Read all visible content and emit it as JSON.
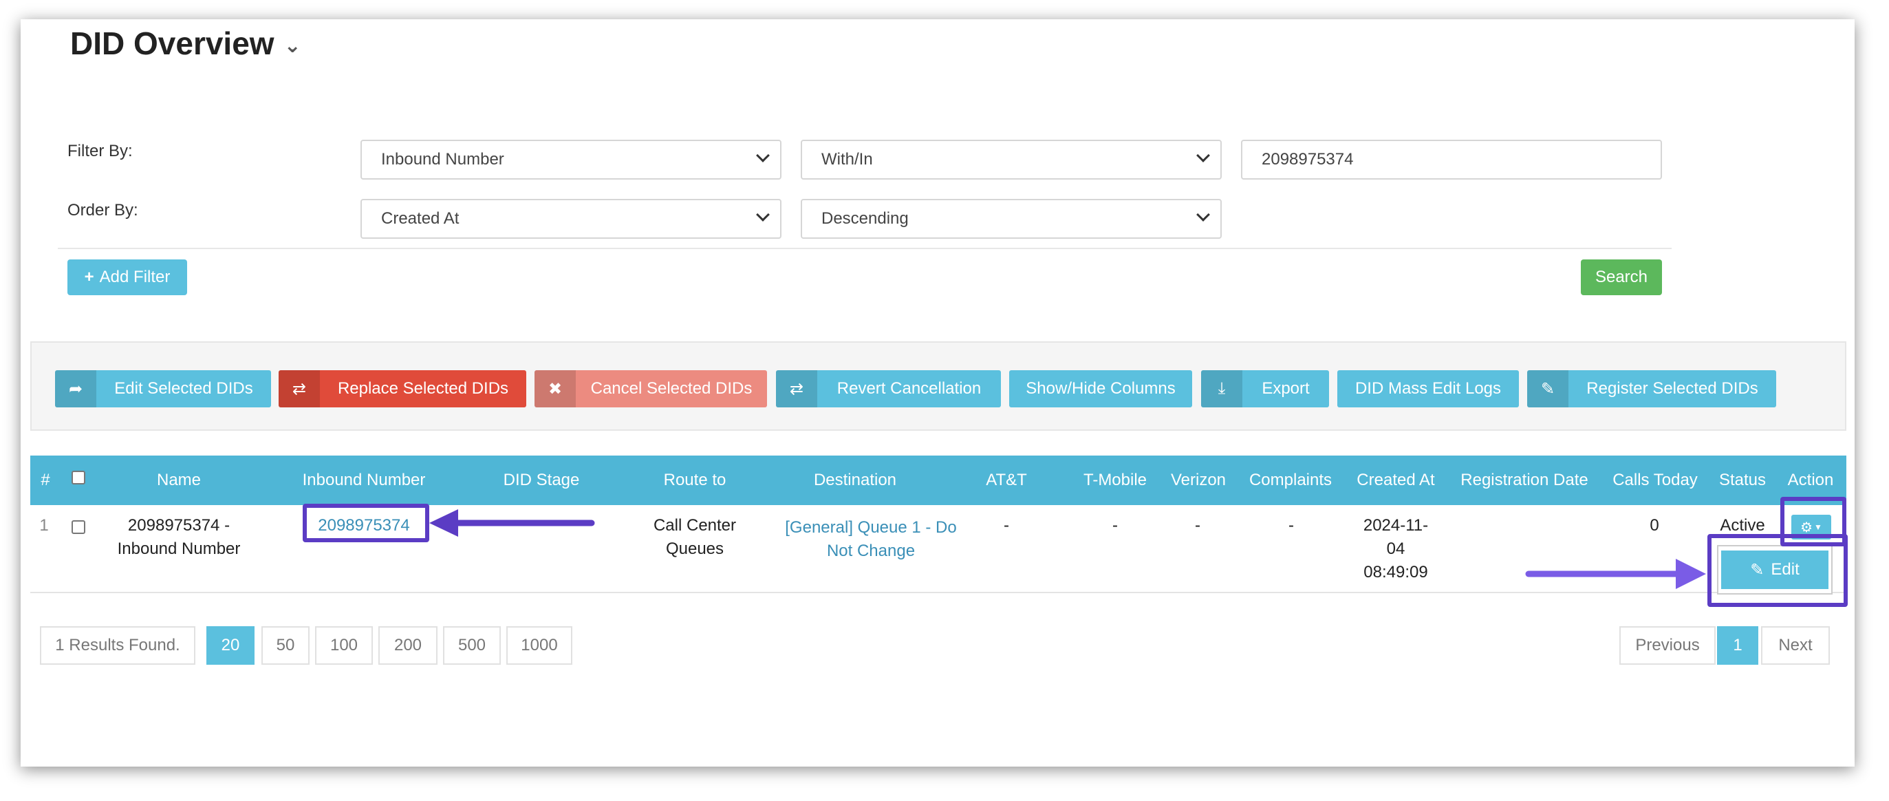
{
  "page": {
    "title": "DID Overview"
  },
  "filters": {
    "filter_by_label": "Filter By:",
    "order_by_label": "Order By:",
    "filter_field": "Inbound Number",
    "filter_operator": "With/In",
    "filter_value": "2098975374",
    "order_field": "Created At",
    "order_direction": "Descending",
    "add_filter_label": "Add Filter",
    "search_label": "Search"
  },
  "toolbar": {
    "buttons": [
      {
        "label": "Edit Selected DIDs",
        "icon": "share-arrow-icon"
      },
      {
        "label": "Replace Selected DIDs",
        "icon": "retweet-icon"
      },
      {
        "label": "Cancel Selected DIDs",
        "icon": "times-icon"
      },
      {
        "label": "Revert Cancellation",
        "icon": "retweet-icon"
      },
      {
        "label": "Show/Hide Columns"
      },
      {
        "label": "Export",
        "icon": "download-icon"
      },
      {
        "label": "DID Mass Edit Logs"
      },
      {
        "label": "Register Selected DIDs",
        "icon": "edit-square-icon"
      }
    ]
  },
  "table": {
    "columns": [
      "#",
      "Name",
      "Inbound Number",
      "DID Stage",
      "Route to",
      "Destination",
      "AT&T",
      "T-Mobile",
      "Verizon",
      "Complaints",
      "Created At",
      "Registration Date",
      "Calls Today",
      "Status",
      "Action"
    ],
    "rows": [
      {
        "index": "1",
        "name_line1": "2098975374 -",
        "name_line2": "Inbound Number",
        "inbound_number": "2098975374",
        "did_stage": "",
        "route_line1": "Call Center",
        "route_line2": "Queues",
        "destination_line1": "[General] Queue 1 - Do",
        "destination_line2": "Not Change",
        "att": "-",
        "tmobile": "-",
        "verizon": "-",
        "complaints": "-",
        "created_line1": "2024-11-",
        "created_line2": "04",
        "created_line3": "08:49:09",
        "registration_date": "",
        "calls_today": "0",
        "status": "Active",
        "edit_label": "Edit"
      }
    ]
  },
  "pagination": {
    "results_text": "1 Results Found.",
    "page_sizes": [
      "20",
      "50",
      "100",
      "200",
      "500",
      "1000"
    ],
    "selected_page_size": "20",
    "previous_label": "Previous",
    "current_page": "1",
    "next_label": "Next"
  },
  "colors": {
    "info": "#5bc0de",
    "danger": "#e04b3a",
    "success": "#5cb85c",
    "annotation": "#5b3cc4"
  }
}
